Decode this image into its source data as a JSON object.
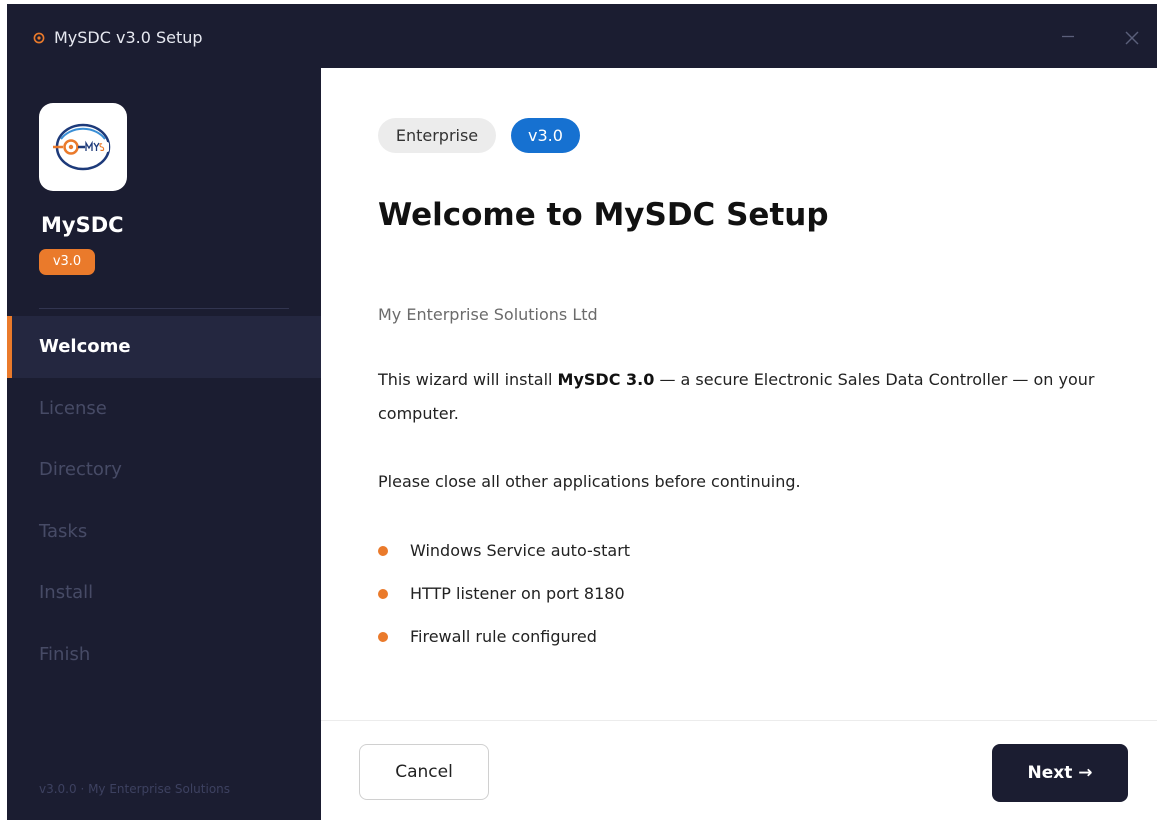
{
  "window": {
    "title": "MySDC v3.0 Setup"
  },
  "sidebar": {
    "app_name": "MySDC",
    "version_badge": "v3.0",
    "steps": [
      {
        "label": "Welcome",
        "active": true
      },
      {
        "label": "License",
        "active": false
      },
      {
        "label": "Directory",
        "active": false
      },
      {
        "label": "Tasks",
        "active": false
      },
      {
        "label": "Install",
        "active": false
      },
      {
        "label": "Finish",
        "active": false
      }
    ],
    "footer": "v3.0.0 · My Enterprise Solutions"
  },
  "main": {
    "badges": {
      "edition": "Enterprise",
      "version": "v3.0"
    },
    "heading": "Welcome to MySDC Setup",
    "company": "My Enterprise Solutions Ltd",
    "intro": {
      "before": "This wizard will install ",
      "product": "MySDC 3.0",
      "after": " — a secure Electronic Sales Data Controller — on your computer."
    },
    "note": "Please close all other applications before continuing.",
    "features": [
      "Windows Service auto-start",
      "HTTP listener on port 8180",
      "Firewall rule configured"
    ]
  },
  "footer": {
    "cancel_label": "Cancel",
    "next_label": "Next →"
  },
  "colors": {
    "sidebar_bg": "#1b1d31",
    "accent": "#ea7a2b",
    "version_blue": "#1671d1"
  },
  "icons": {
    "title": "target-icon",
    "app": "mysdc-logo-icon",
    "minimize": "minimize-icon",
    "close": "close-icon",
    "bullet": "bullet-dot-icon"
  }
}
